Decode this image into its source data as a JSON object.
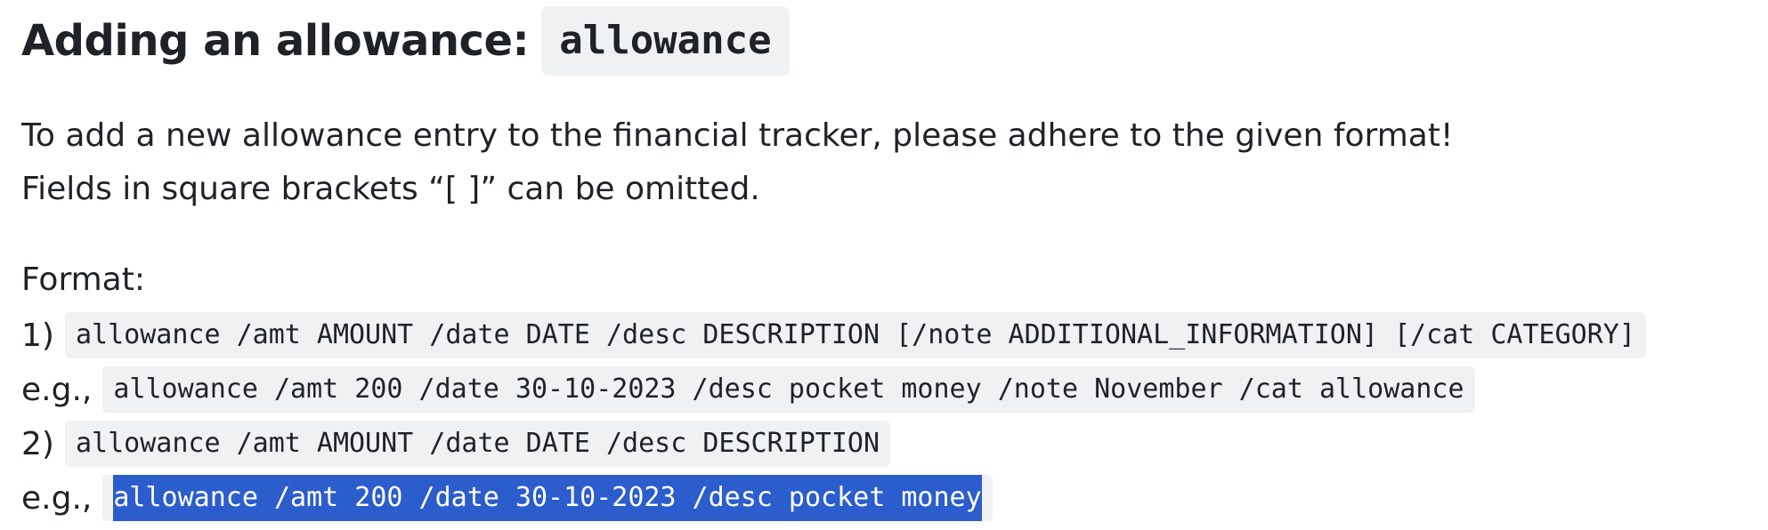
{
  "heading": {
    "text": "Adding an allowance:",
    "code": "allowance"
  },
  "intro": {
    "line1": "To add a new allowance entry to the financial tracker, please adhere to the given format!",
    "line2": "Fields in square brackets “[ ]” can be omitted."
  },
  "format": {
    "label": "Format:",
    "items": [
      {
        "prefix": "1)",
        "syntax": "allowance /amt AMOUNT /date DATE /desc DESCRIPTION [/note ADDITIONAL_INFORMATION] [/cat CATEGORY]",
        "example_prefix": "e.g.,",
        "example": "allowance /amt 200 /date 30-10-2023 /desc pocket money /note November /cat allowance"
      },
      {
        "prefix": "2)",
        "syntax": "allowance /amt AMOUNT /date DATE /desc DESCRIPTION",
        "example_prefix": "e.g.,",
        "example": "allowance /amt 200 /date 30-10-2023 /desc pocket money"
      }
    ]
  },
  "colors": {
    "text": "#1f2328",
    "code_background": "#eff1f3",
    "selection_background": "#2b5dcd",
    "selection_text": "#ffffff"
  }
}
